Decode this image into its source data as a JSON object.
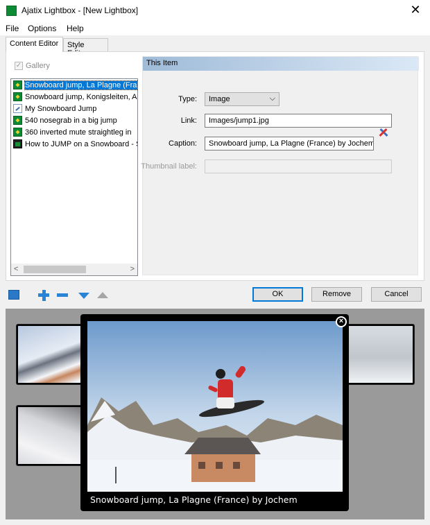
{
  "window": {
    "title": "Ajatix Lightbox - [New Lightbox]",
    "close_glyph": "✕"
  },
  "menu": {
    "items": [
      "File",
      "Options",
      "Help"
    ]
  },
  "tabs": [
    {
      "label": "Content Editor"
    },
    {
      "label": "Style Editor"
    }
  ],
  "gallery": {
    "label": "Gallery",
    "checked_glyph": "✓"
  },
  "items": [
    {
      "label": "Snowboard jump, La Plagne (France) by Jochem",
      "type": "image"
    },
    {
      "label": "Snowboard jump, Konigsleiten, Austria",
      "type": "image"
    },
    {
      "label": "My Snowboard Jump",
      "type": "link"
    },
    {
      "label": "540 nosegrab in a big jump",
      "type": "image"
    },
    {
      "label": "360 inverted mute straightleg in",
      "type": "image"
    },
    {
      "label": "How to JUMP on a Snowboard - Snowboarding",
      "type": "video"
    }
  ],
  "scrollbar": {
    "left_glyph": "<",
    "right_glyph": ">"
  },
  "detail": {
    "header": "This Item",
    "type_label": "Type:",
    "type_value": "Image",
    "type_caret": "⌵",
    "link_label": "Link:",
    "link_value": "Images/jump1.jpg",
    "caption_label": "Caption:",
    "caption_value": "Snowboard jump, La Plagne (France) by Jochem",
    "thumbnail_label": "Thumbnail label:",
    "thumbnail_value": ""
  },
  "buttons": {
    "ok": "OK",
    "remove": "Remove",
    "cancel": "Cancel"
  },
  "preview": {
    "caption": "Snowboard jump, La Plagne (France) by Jochem",
    "close_glyph": "×"
  },
  "colors": {
    "accent": "#0078d7",
    "header_gradient_start": "#9fbbd8",
    "preview_bg": "#9a9a9a"
  }
}
